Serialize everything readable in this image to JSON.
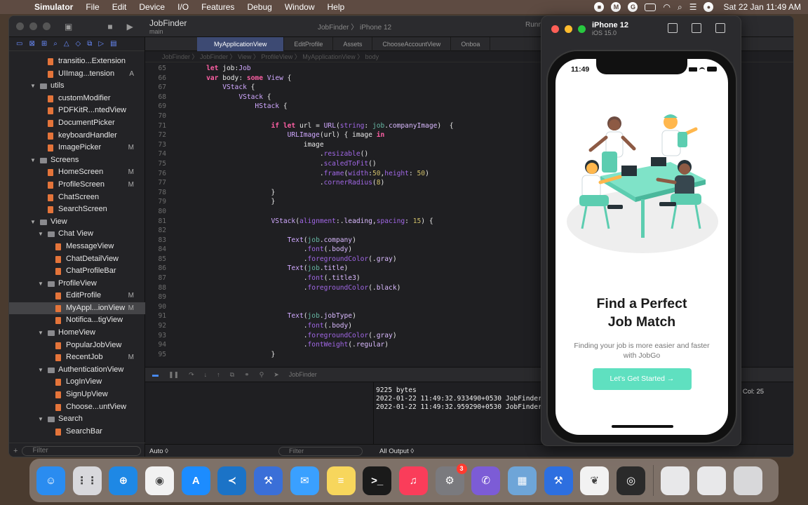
{
  "menubar": {
    "items": [
      "Simulator",
      "File",
      "Edit",
      "Device",
      "I/O",
      "Features",
      "Debug",
      "Window",
      "Help"
    ],
    "clock": "Sat 22 Jan  11:49 AM"
  },
  "xcode": {
    "scheme_name": "JobFinder",
    "scheme_branch": "main",
    "target": "JobFinder 〉 iPhone 12",
    "run_status": "Runni",
    "tabs": [
      "MyApplicationView",
      "EditProfile",
      "Assets",
      "ChooseAccountView",
      "Onboa"
    ],
    "jumpbar": "JobFinder 〉 JobFinder 〉 View 〉 ProfileView 〉 MyApplicationView 〉 body",
    "navigator": [
      {
        "label": "transitio...Extension",
        "level": 3,
        "kind": "swift",
        "badge": ""
      },
      {
        "label": "UIImag...tension",
        "level": 3,
        "kind": "swift",
        "badge": "A"
      },
      {
        "label": "utils",
        "level": 2,
        "kind": "folder",
        "badge": ""
      },
      {
        "label": "customModifier",
        "level": 3,
        "kind": "swift",
        "badge": ""
      },
      {
        "label": "PDFKitR...ntedView",
        "level": 3,
        "kind": "swift",
        "badge": ""
      },
      {
        "label": "DocumentPicker",
        "level": 3,
        "kind": "swift",
        "badge": ""
      },
      {
        "label": "keyboardHandler",
        "level": 3,
        "kind": "swift",
        "badge": ""
      },
      {
        "label": "ImagePicker",
        "level": 3,
        "kind": "swift",
        "badge": "M"
      },
      {
        "label": "Screens",
        "level": 2,
        "kind": "folder",
        "badge": ""
      },
      {
        "label": "HomeScreen",
        "level": 3,
        "kind": "swift",
        "badge": "M"
      },
      {
        "label": "ProfileScreen",
        "level": 3,
        "kind": "swift",
        "badge": "M"
      },
      {
        "label": "ChatScreen",
        "level": 3,
        "kind": "swift",
        "badge": ""
      },
      {
        "label": "SearchScreen",
        "level": 3,
        "kind": "swift",
        "badge": ""
      },
      {
        "label": "View",
        "level": 2,
        "kind": "folder",
        "badge": ""
      },
      {
        "label": "Chat View",
        "level": 3,
        "kind": "folder",
        "badge": ""
      },
      {
        "label": "MessageView",
        "level": 4,
        "kind": "swift",
        "badge": ""
      },
      {
        "label": "ChatDetailView",
        "level": 4,
        "kind": "swift",
        "badge": ""
      },
      {
        "label": "ChatProfileBar",
        "level": 4,
        "kind": "swift",
        "badge": ""
      },
      {
        "label": "ProfileView",
        "level": 3,
        "kind": "folder",
        "badge": ""
      },
      {
        "label": "EditProfile",
        "level": 4,
        "kind": "swift",
        "badge": "M"
      },
      {
        "label": "MyAppl...ionView",
        "level": 4,
        "kind": "swift",
        "badge": "M",
        "selected": true
      },
      {
        "label": "Notifica...tigView",
        "level": 4,
        "kind": "swift",
        "badge": ""
      },
      {
        "label": "HomeView",
        "level": 3,
        "kind": "folder",
        "badge": ""
      },
      {
        "label": "PopularJobView",
        "level": 4,
        "kind": "swift",
        "badge": ""
      },
      {
        "label": "RecentJob",
        "level": 4,
        "kind": "swift",
        "badge": "M"
      },
      {
        "label": "AuthenticationView",
        "level": 3,
        "kind": "folder",
        "badge": ""
      },
      {
        "label": "LogInView",
        "level": 4,
        "kind": "swift",
        "badge": ""
      },
      {
        "label": "SignUpView",
        "level": 4,
        "kind": "swift",
        "badge": ""
      },
      {
        "label": "Choose...untView",
        "level": 4,
        "kind": "swift",
        "badge": ""
      },
      {
        "label": "Search",
        "level": 3,
        "kind": "folder",
        "badge": ""
      },
      {
        "label": "SearchBar",
        "level": 4,
        "kind": "swift",
        "badge": ""
      }
    ],
    "nav_filter_placeholder": "Filter",
    "code_lines": [
      {
        "n": "65",
        "html": "    <span class=\"kw\">let</span> job:<span class=\"ty\">Job</span>"
      },
      {
        "n": "66",
        "html": "    <span class=\"kw\">var</span> body: <span class=\"kw\">some</span> <span class=\"ty\">View</span> {"
      },
      {
        "n": "67",
        "html": "        <span class=\"ty\">VStack</span> {"
      },
      {
        "n": "68",
        "html": "            <span class=\"ty\">VStack</span> {"
      },
      {
        "n": "69",
        "html": "                <span class=\"ty\">HStack</span> {"
      },
      {
        "n": "70",
        "html": ""
      },
      {
        "n": "71",
        "html": "                    <span class=\"kw\">if</span> <span class=\"kw\">let</span> url = <span class=\"ty\">URL</span>(<span class=\"fn\">string</span>: <span class=\"mem\">job</span>.<span class=\"pr\">companyImage</span>)  {"
      },
      {
        "n": "72",
        "html": "                        <span class=\"ty\">URLImage</span>(url) { image <span class=\"kw\">in</span>"
      },
      {
        "n": "73",
        "html": "                            image"
      },
      {
        "n": "74",
        "html": "                                .<span class=\"fn\">resizable</span>()"
      },
      {
        "n": "75",
        "html": "                                .<span class=\"fn\">scaledToFit</span>()"
      },
      {
        "n": "76",
        "html": "                                .<span class=\"fn\">frame</span>(<span class=\"fn\">width</span>:<span class=\"num\">50</span>,<span class=\"fn\">height</span>: <span class=\"num\">50</span>)"
      },
      {
        "n": "77",
        "html": "                                .<span class=\"fn\">cornerRadius</span>(<span class=\"num\">8</span>)"
      },
      {
        "n": "78",
        "html": "                    }"
      },
      {
        "n": "79",
        "html": "                    }"
      },
      {
        "n": "80",
        "html": ""
      },
      {
        "n": "81",
        "html": "                    <span class=\"ty\">VStack</span>(<span class=\"fn\">alignment</span>:.<span class=\"pr\">leading</span>,<span class=\"fn\">spacing</span>: <span class=\"num\">15</span>) {"
      },
      {
        "n": "82",
        "html": ""
      },
      {
        "n": "83",
        "html": "                        <span class=\"ty\">Text</span>(<span class=\"mem\">job</span>.<span class=\"pr\">company</span>)"
      },
      {
        "n": "84",
        "html": "                            .<span class=\"fn\">font</span>(.<span class=\"pr\">body</span>)"
      },
      {
        "n": "85",
        "html": "                            .<span class=\"fn\">foregroundColor</span>(.<span class=\"pr\">gray</span>)"
      },
      {
        "n": "86",
        "html": "                        <span class=\"ty\">Text</span>(<span class=\"mem\">job</span>.<span class=\"pr\">title</span>)"
      },
      {
        "n": "87",
        "html": "                            .<span class=\"fn\">font</span>(.<span class=\"pr\">title3</span>)"
      },
      {
        "n": "88",
        "html": "                            .<span class=\"fn\">foregroundColor</span>(.<span class=\"pr\">black</span>)"
      },
      {
        "n": "89",
        "html": ""
      },
      {
        "n": "90",
        "html": ""
      },
      {
        "n": "91",
        "html": "                        <span class=\"ty\">Text</span>(<span class=\"mem\">job</span>.<span class=\"pr\">jobType</span>)"
      },
      {
        "n": "92",
        "html": "                            .<span class=\"fn\">font</span>(.<span class=\"pr\">body</span>)"
      },
      {
        "n": "93",
        "html": "                            .<span class=\"fn\">foregroundColor</span>(.<span class=\"pr\">gray</span>)"
      },
      {
        "n": "94",
        "html": "                            .<span class=\"fn\">fontWeight</span>(.<span class=\"pr\">regular</span>)"
      },
      {
        "n": "95",
        "html": "                    }"
      }
    ],
    "debug_target": "JobFinder",
    "console_lines": [
      "9225 bytes",
      "2022-01-22 11:49:32.933490+0530 JobFinder",
      "2022-01-22 11:49:32.959290+0530 JobFinder"
    ],
    "footer_auto": "Auto ◊",
    "footer_filter": "Filter",
    "footer_output": "All Output ◊",
    "col_readout": "2  Col: 25"
  },
  "simulator": {
    "device": "iPhone 12",
    "os": "iOS 15.0",
    "status_time": "11:49",
    "headline": "Find a Perfect\nJob Match",
    "subline": "Finding your job is more easier and faster with JobGo",
    "cta": "Let's Get Started →"
  },
  "dock": [
    {
      "name": "finder",
      "color": "#2a8cf0",
      "glyph": "☺"
    },
    {
      "name": "launchpad",
      "color": "#d8d8dc",
      "glyph": "⋮⋮"
    },
    {
      "name": "safari",
      "color": "#1e88e5",
      "glyph": "⊕"
    },
    {
      "name": "chrome",
      "color": "#f2f2f2",
      "glyph": "◉"
    },
    {
      "name": "app-store",
      "color": "#1c8cff",
      "glyph": "A"
    },
    {
      "name": "vscode",
      "color": "#1b73c7",
      "glyph": "≺"
    },
    {
      "name": "xcode-beta",
      "color": "#3a6fd8",
      "glyph": "⚒"
    },
    {
      "name": "mail",
      "color": "#3aa0ff",
      "glyph": "✉"
    },
    {
      "name": "notes",
      "color": "#f7d65c",
      "glyph": "≡"
    },
    {
      "name": "terminal",
      "color": "#1a1a1a",
      "glyph": ">_"
    },
    {
      "name": "music",
      "color": "#fa3d5a",
      "glyph": "♫"
    },
    {
      "name": "system-preferences",
      "color": "#7a7a7e",
      "glyph": "⚙",
      "badge": "3"
    },
    {
      "name": "viber",
      "color": "#7c5cd6",
      "glyph": "✆"
    },
    {
      "name": "preview",
      "color": "#6ea5d8",
      "glyph": "▦"
    },
    {
      "name": "xcode",
      "color": "#2d6fe0",
      "glyph": "⚒"
    },
    {
      "name": "mongodb",
      "color": "#f2f2f2",
      "glyph": "❦"
    },
    {
      "name": "quicktime",
      "color": "#2a2a2a",
      "glyph": "◎"
    }
  ],
  "dock_right": [
    {
      "name": "recent-window-1",
      "color": "#e8e8ea"
    },
    {
      "name": "recent-window-2",
      "color": "#e8e8ea"
    },
    {
      "name": "trash",
      "color": "#d8d8da"
    }
  ]
}
